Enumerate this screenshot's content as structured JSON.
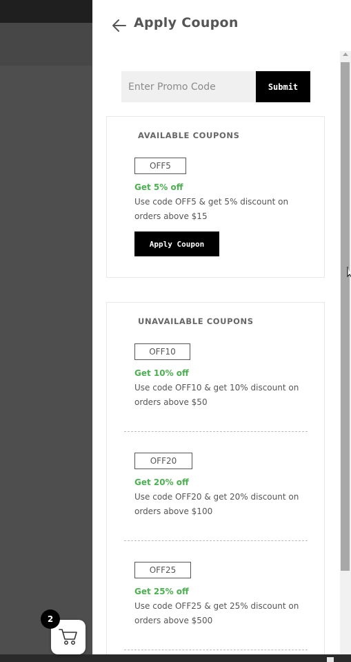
{
  "header": {
    "title": "Apply Coupon",
    "back_icon": "arrow-left-icon"
  },
  "promo": {
    "placeholder": "Enter Promo Code",
    "value": "",
    "submit_label": "Submit"
  },
  "available": {
    "heading": "AVAILABLE COUPONS",
    "coupons": [
      {
        "code": "OFF5",
        "offer": "Get 5% off",
        "desc_line1": "Use code OFF5 & get 5% discount on",
        "desc_line2": "orders above $15",
        "button_label": "Apply Coupon"
      }
    ]
  },
  "unavailable": {
    "heading": "UNAVAILABLE COUPONS",
    "coupons": [
      {
        "code": "OFF10",
        "offer": "Get 10% off",
        "desc_line1": "Use code OFF10 & get 10% discount on",
        "desc_line2": "orders above $50"
      },
      {
        "code": "OFF20",
        "offer": "Get 20% off",
        "desc_line1": "Use code OFF20 & get 20% discount on",
        "desc_line2": "orders above $100"
      },
      {
        "code": "OFF25",
        "offer": "Get 25% off",
        "desc_line1": "Use code OFF25 & get 25% discount on",
        "desc_line2": "orders above $500"
      }
    ]
  },
  "cart": {
    "count": "2",
    "icon": "cart-icon"
  },
  "colors": {
    "accent_green": "#4caf50",
    "button_black": "#000000",
    "overlay": "#4e4e4e"
  }
}
